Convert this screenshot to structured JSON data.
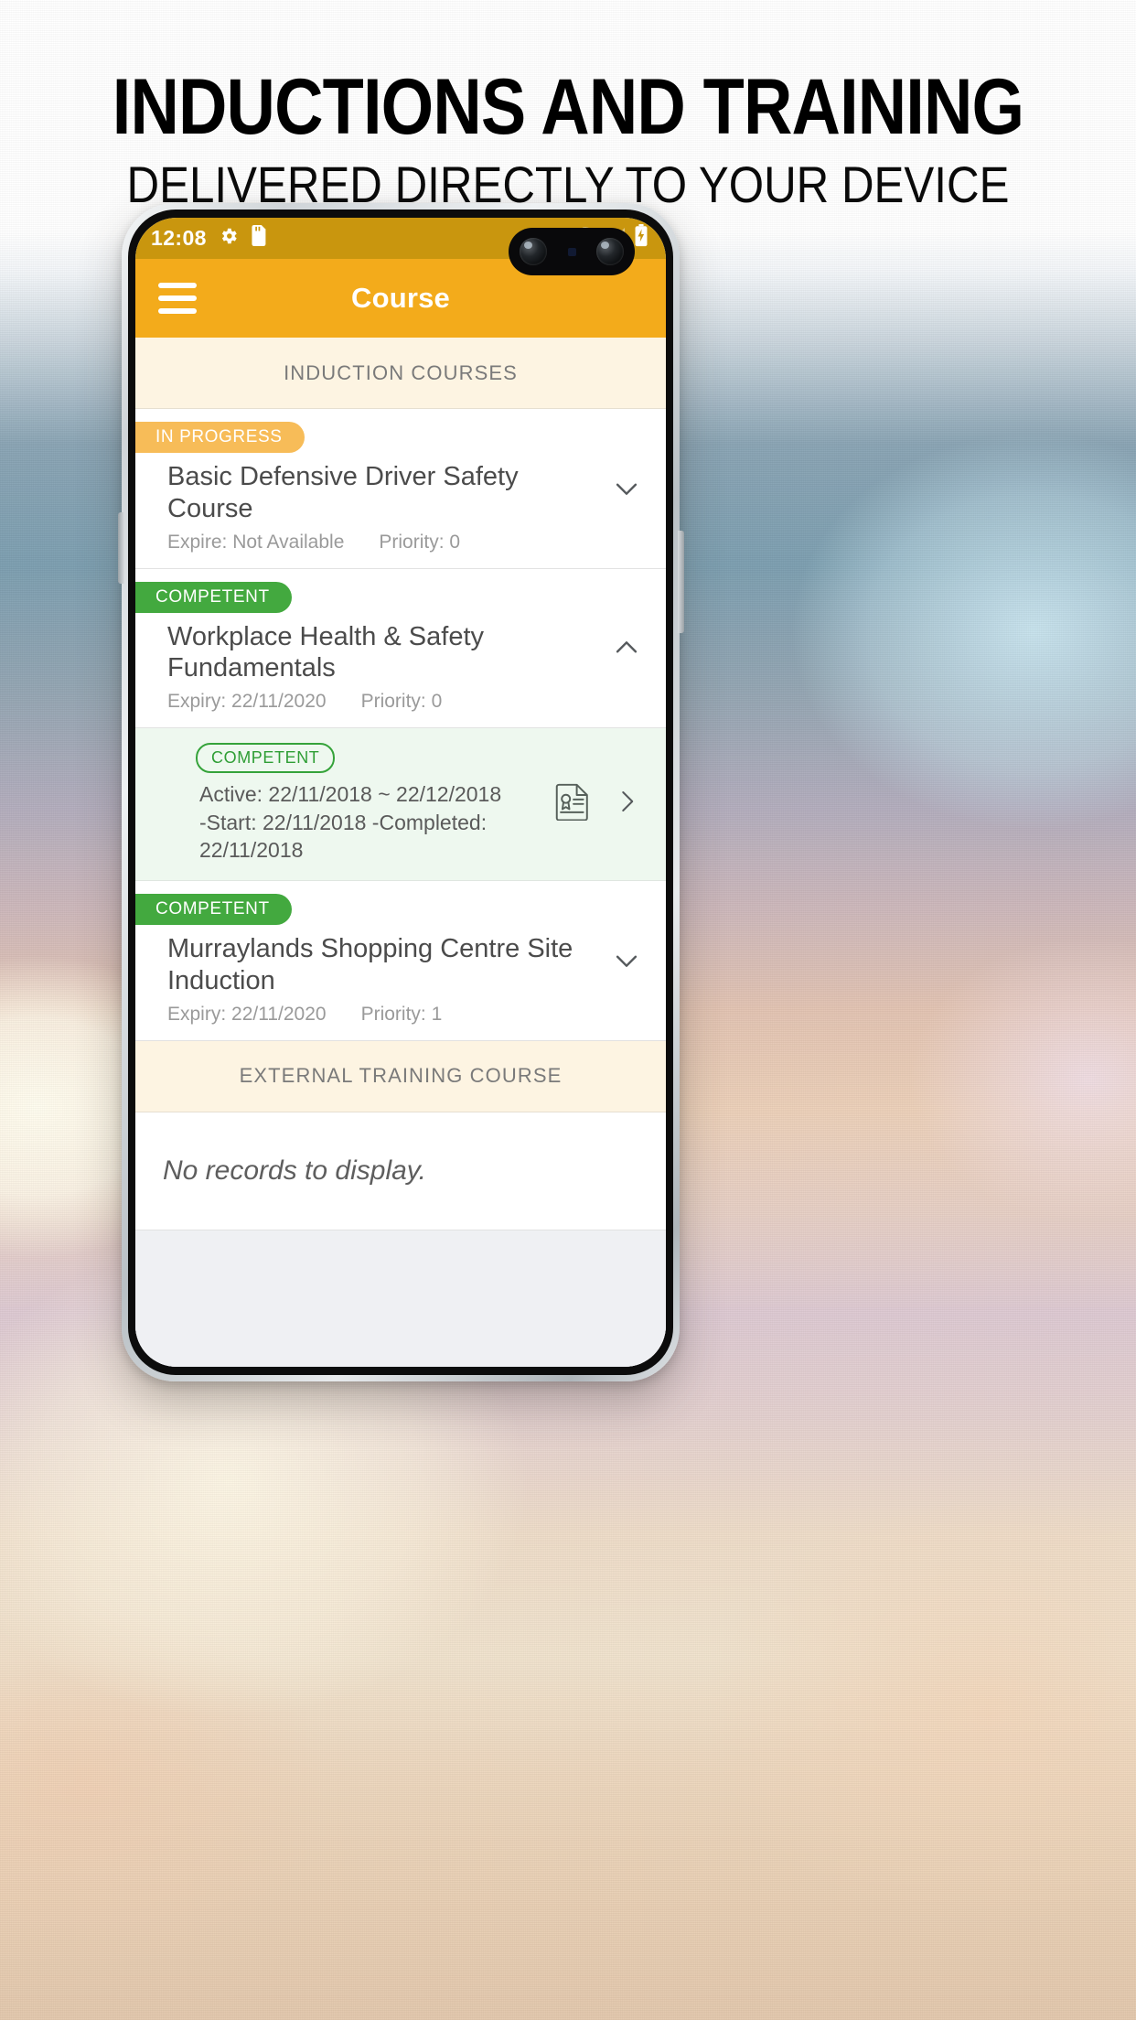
{
  "promo": {
    "headline": "INDUCTIONS AND TRAINING",
    "subheadline": "DELIVERED DIRECTLY TO YOUR DEVICE"
  },
  "status_bar": {
    "time": "12:08",
    "icons": [
      "gear-icon",
      "sd-card-icon"
    ],
    "right_icons": [
      "wifi-icon",
      "cellular-signal-icon",
      "battery-charging-icon"
    ]
  },
  "app_bar": {
    "menu_icon": "hamburger-menu-icon",
    "title": "Course"
  },
  "sections": [
    {
      "header": "INDUCTION COURSES",
      "courses": [
        {
          "status": "IN PROGRESS",
          "status_color": "#f7bc58",
          "title": "Basic Defensive Driver Safety Course",
          "expiry_label": "Expire: Not Available",
          "priority_label": "Priority: 0",
          "expanded": false,
          "chevron": "chevron-down-icon"
        },
        {
          "status": "COMPETENT",
          "status_color": "#43a93f",
          "title": "Workplace Health & Safety Fundamentals",
          "expiry_label": "Expiry: 22/11/2020",
          "priority_label": "Priority: 0",
          "expanded": true,
          "chevron": "chevron-up-icon",
          "detail": {
            "status": "COMPETENT",
            "active_line": "Active: 22/11/2018 ~ 22/12/2018",
            "dates_line": "-Start: 22/11/2018  -Completed: 22/11/2018",
            "certificate_icon": "certificate-document-icon",
            "chevron": "chevron-right-icon"
          }
        },
        {
          "status": "COMPETENT",
          "status_color": "#43a93f",
          "title": "Murraylands Shopping Centre Site Induction",
          "expiry_label": "Expiry: 22/11/2020",
          "priority_label": "Priority: 1",
          "expanded": false,
          "chevron": "chevron-down-icon"
        }
      ]
    },
    {
      "header": "EXTERNAL TRAINING COURSE",
      "empty_text": "No records to display."
    }
  ],
  "colors": {
    "accent": "#f3ab1b",
    "status_bar": "#c9960e",
    "section_bg": "#fdf4e2",
    "competent": "#43a93f",
    "in_progress": "#f7bc58",
    "detail_bg": "#eef8ef"
  }
}
